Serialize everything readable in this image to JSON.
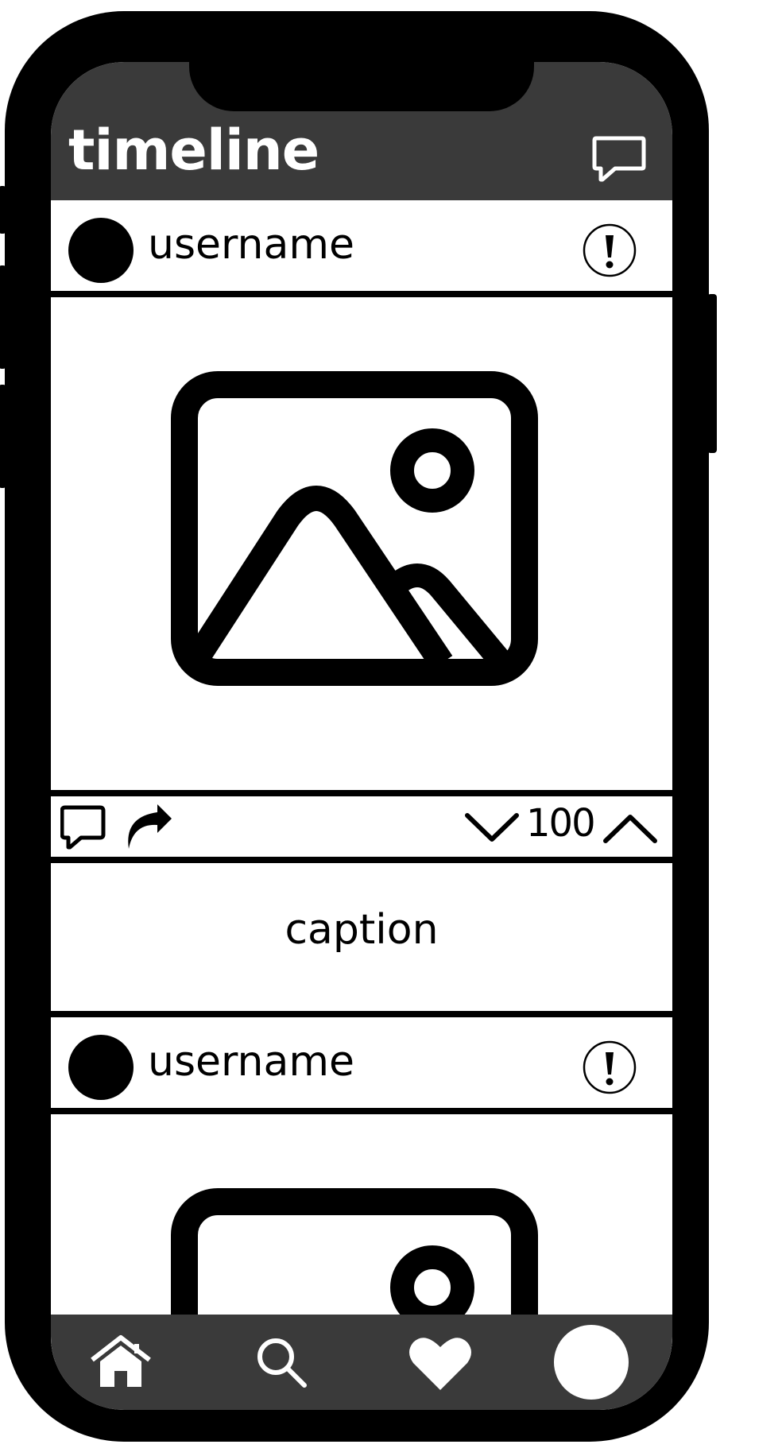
{
  "header": {
    "title": "timeline"
  },
  "posts": [
    {
      "username": "username",
      "score": "100",
      "caption": "caption"
    },
    {
      "username": "username"
    }
  ],
  "icons": {
    "messages": "chat-bubble-icon",
    "report": "exclamation-icon",
    "comment": "comment-icon",
    "share": "share-icon",
    "downvote": "chevron-down-icon",
    "upvote": "chevron-up-icon",
    "image": "image-placeholder-icon",
    "home": "home-icon",
    "search": "search-icon",
    "likes": "heart-icon",
    "profile": "profile-avatar-icon"
  },
  "colors": {
    "frame": "#000000",
    "bar": "#3a3a3a",
    "surface": "#ffffff"
  }
}
